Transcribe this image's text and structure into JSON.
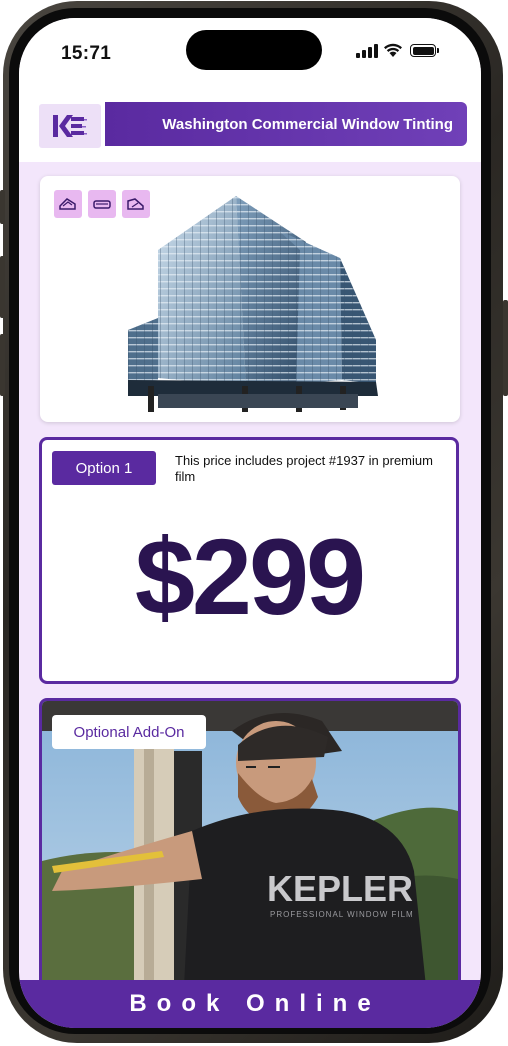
{
  "status_bar": {
    "time": "15:71"
  },
  "header": {
    "title": "Washington Commercial Window Tinting",
    "logo_text": "KE"
  },
  "image_card": {
    "icons": [
      "tint-film-icon",
      "window-film-icon",
      "tint-film-icon"
    ]
  },
  "option": {
    "label": "Option 1",
    "note": "This price includes project #1937 in premium film",
    "price": "$299"
  },
  "addon": {
    "label": "Optional Add-On",
    "shirt_text": "KEPLER",
    "shirt_subtext": "PROFESSIONAL WINDOW FILM"
  },
  "cta": {
    "label": "Book Online"
  },
  "colors": {
    "brand": "#5a2aa0",
    "price": "#2a1450",
    "background": "#f3e6fb",
    "icon_bg": "#e8b8f0"
  }
}
